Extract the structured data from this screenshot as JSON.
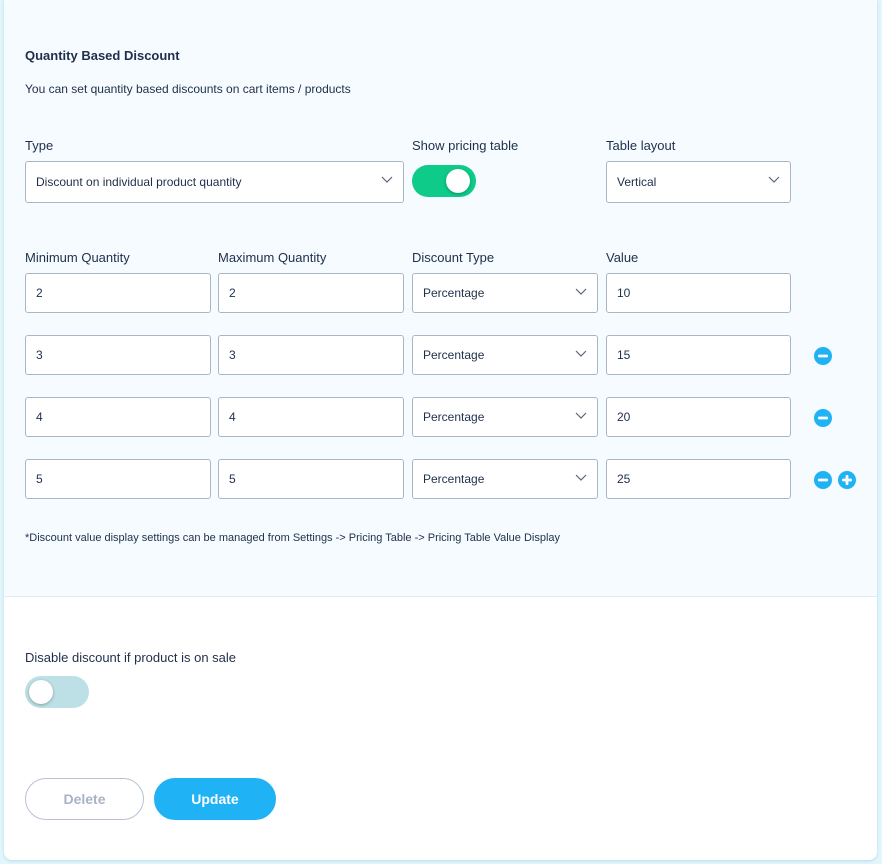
{
  "section": {
    "title": "Quantity Based Discount",
    "description": "You can set quantity based discounts on cart items / products"
  },
  "type_field": {
    "label": "Type",
    "value": "Discount on individual product quantity"
  },
  "pricing_table_toggle": {
    "label": "Show pricing table",
    "on": true,
    "color": "#0ecb8a"
  },
  "table_layout": {
    "label": "Table layout",
    "value": "Vertical"
  },
  "tiers": {
    "headers": {
      "min": "Minimum Quantity",
      "max": "Maximum Quantity",
      "discount_type": "Discount Type",
      "value": "Value"
    },
    "rows": [
      {
        "min": "2",
        "max": "2",
        "discount_type": "Percentage",
        "value": "10",
        "actions": []
      },
      {
        "min": "3",
        "max": "3",
        "discount_type": "Percentage",
        "value": "15",
        "actions": [
          "remove"
        ]
      },
      {
        "min": "4",
        "max": "4",
        "discount_type": "Percentage",
        "value": "20",
        "actions": [
          "remove"
        ]
      },
      {
        "min": "5",
        "max": "5",
        "discount_type": "Percentage",
        "value": "25",
        "actions": [
          "remove",
          "add"
        ]
      }
    ]
  },
  "note": "*Discount value display settings can be managed from Settings -> Pricing Table -> Pricing Table Value Display",
  "sale_toggle": {
    "label": "Disable discount if product is on sale",
    "on": false,
    "color": "#bde0e6"
  },
  "buttons": {
    "delete": "Delete",
    "update": "Update"
  },
  "colors": {
    "accent": "#1fb3f5",
    "toggle_on": "#0ecb8a",
    "toggle_off": "#bde0e6"
  }
}
